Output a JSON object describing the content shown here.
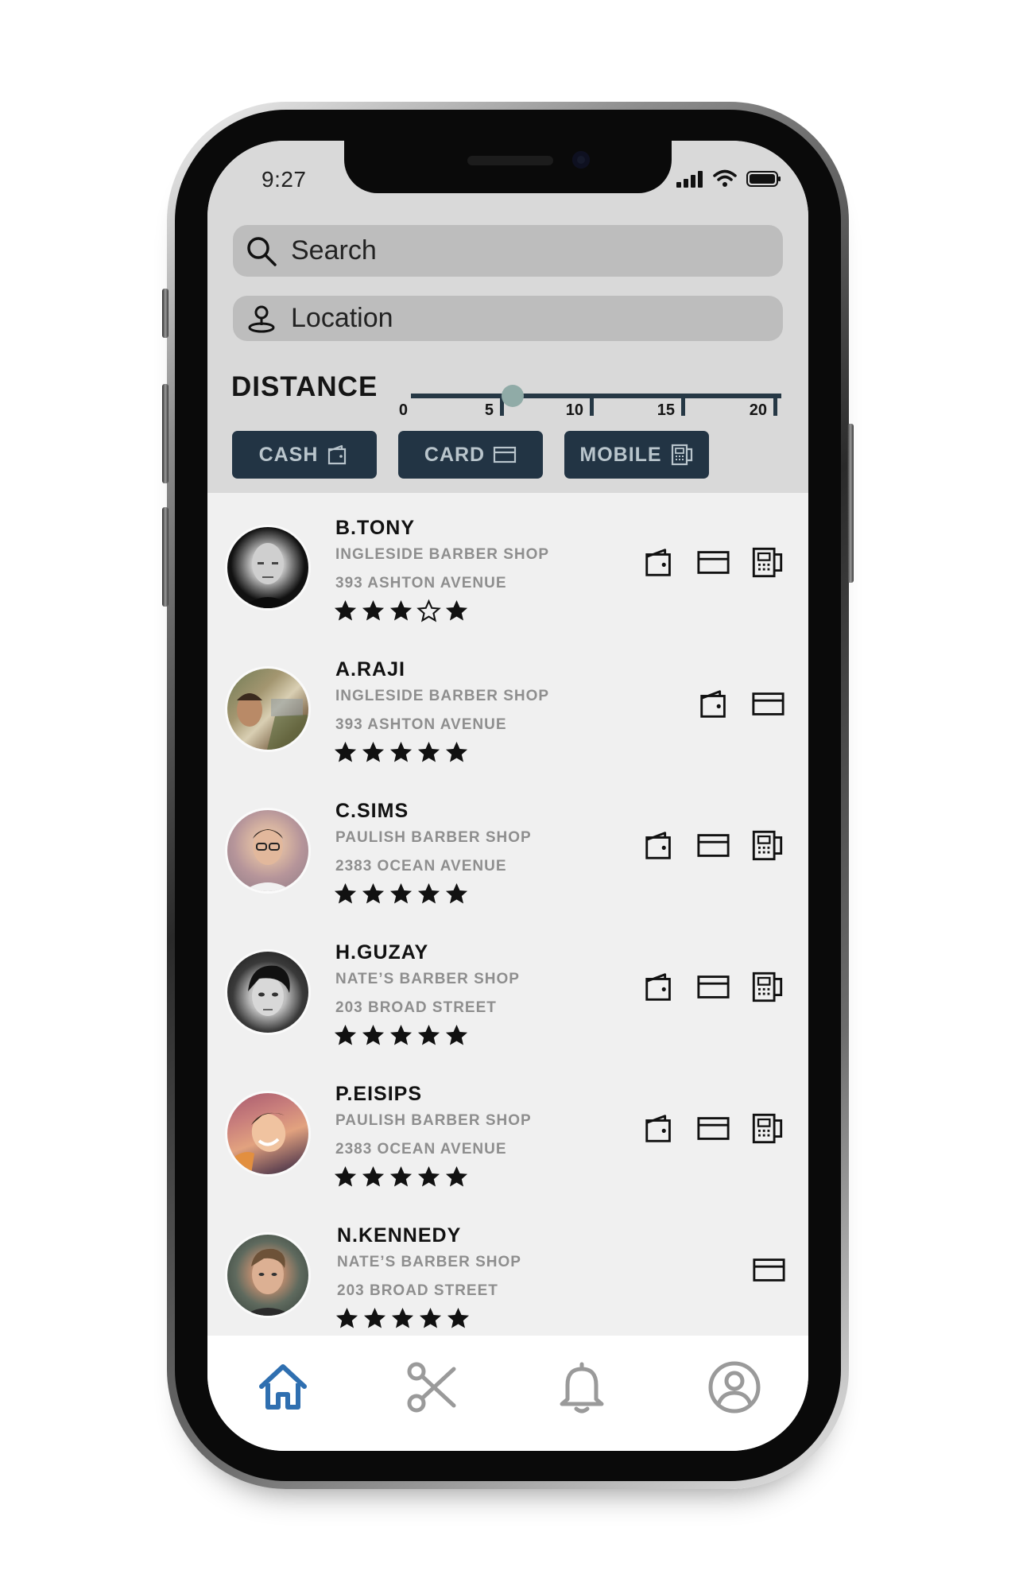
{
  "status_bar": {
    "time": "9:27"
  },
  "search": {
    "placeholder": "Search"
  },
  "location": {
    "placeholder": "Location"
  },
  "distance": {
    "label": "DISTANCE",
    "ticks": [
      "0",
      "5",
      "10",
      "15",
      "20"
    ],
    "value": 5
  },
  "payment_filters": [
    {
      "label": "CASH",
      "icon": "wallet-icon"
    },
    {
      "label": "CARD",
      "icon": "credit-card-icon"
    },
    {
      "label": "MOBILE",
      "icon": "mobile-payment-icon"
    }
  ],
  "barbers": [
    {
      "name": "B.TONY",
      "shop": "INGLESIDE BARBER SHOP",
      "address": "393 ASHTON AVENUE",
      "rating": 4,
      "rating_shown": "3 filled, 1 outline, 1 filled",
      "payments": [
        "cash",
        "card",
        "mobile"
      ]
    },
    {
      "name": "A.RAJI",
      "shop": "INGLESIDE BARBER SHOP",
      "address": "393 ASHTON AVENUE",
      "rating": 5,
      "payments": [
        "cash",
        "card"
      ]
    },
    {
      "name": "C.SIMS",
      "shop": "PAULISH BARBER SHOP",
      "address": "2383 OCEAN AVENUE",
      "rating": 5,
      "payments": [
        "cash",
        "card",
        "mobile"
      ]
    },
    {
      "name": "H.GUZAY",
      "shop": "NATE’S BARBER SHOP",
      "address": "203 BROAD STREET",
      "rating": 5,
      "payments": [
        "cash",
        "card",
        "mobile"
      ]
    },
    {
      "name": "P.EISIPS",
      "shop": "PAULISH BARBER SHOP",
      "address": "2383 OCEAN AVENUE",
      "rating": 5,
      "payments": [
        "cash",
        "card",
        "mobile"
      ]
    },
    {
      "name": "N.KENNEDY",
      "shop": "NATE’S BARBER SHOP",
      "address": "203 BROAD STREET",
      "rating": 5,
      "payments": [
        "card"
      ]
    }
  ],
  "bottom_nav": [
    {
      "icon": "home-icon",
      "active": true
    },
    {
      "icon": "scissors-icon",
      "active": false
    },
    {
      "icon": "bell-icon",
      "active": false
    },
    {
      "icon": "profile-icon",
      "active": false
    }
  ],
  "colors": {
    "filter_bg": "#d9d9d9",
    "field_bg": "#bdbdbd",
    "button_bg": "#223444",
    "button_text": "#b9c5cc",
    "slider_thumb": "#90aba7",
    "list_bg": "#f0f0f0",
    "nav_active": "#2f6fb0",
    "nav_inactive": "#9a9a9a"
  }
}
